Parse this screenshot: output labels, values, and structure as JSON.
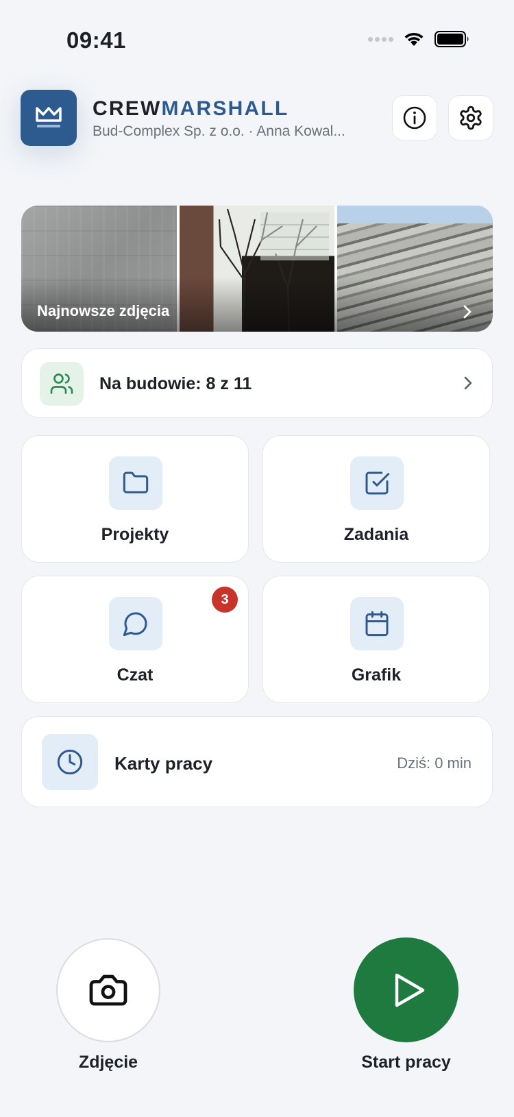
{
  "status_bar": {
    "time": "09:41"
  },
  "header": {
    "brand_part1": "CREW",
    "brand_part2": "MARSHALL",
    "subtitle": "Bud-Complex Sp. z o.o. · Anna Kowal...",
    "brand_color": "#2d5a8f"
  },
  "photos": {
    "label": "Najnowsze zdjęcia"
  },
  "onsite": {
    "label": "Na budowie: 8 z 11"
  },
  "tiles": [
    {
      "label": "Projekty",
      "icon": "folder-icon"
    },
    {
      "label": "Zadania",
      "icon": "checkbox-icon"
    },
    {
      "label": "Czat",
      "icon": "chat-icon",
      "badge": "3"
    },
    {
      "label": "Grafik",
      "icon": "calendar-icon"
    }
  ],
  "timecards": {
    "label": "Karty pracy",
    "value": "Dziś: 0 min"
  },
  "actions": {
    "photo_label": "Zdjęcie",
    "start_label": "Start pracy",
    "start_color": "#1f7a3f"
  },
  "colors": {
    "accent": "#2d5a8f",
    "success": "#1f7a3f",
    "badge": "#c8342a",
    "background": "#f3f5f8"
  }
}
